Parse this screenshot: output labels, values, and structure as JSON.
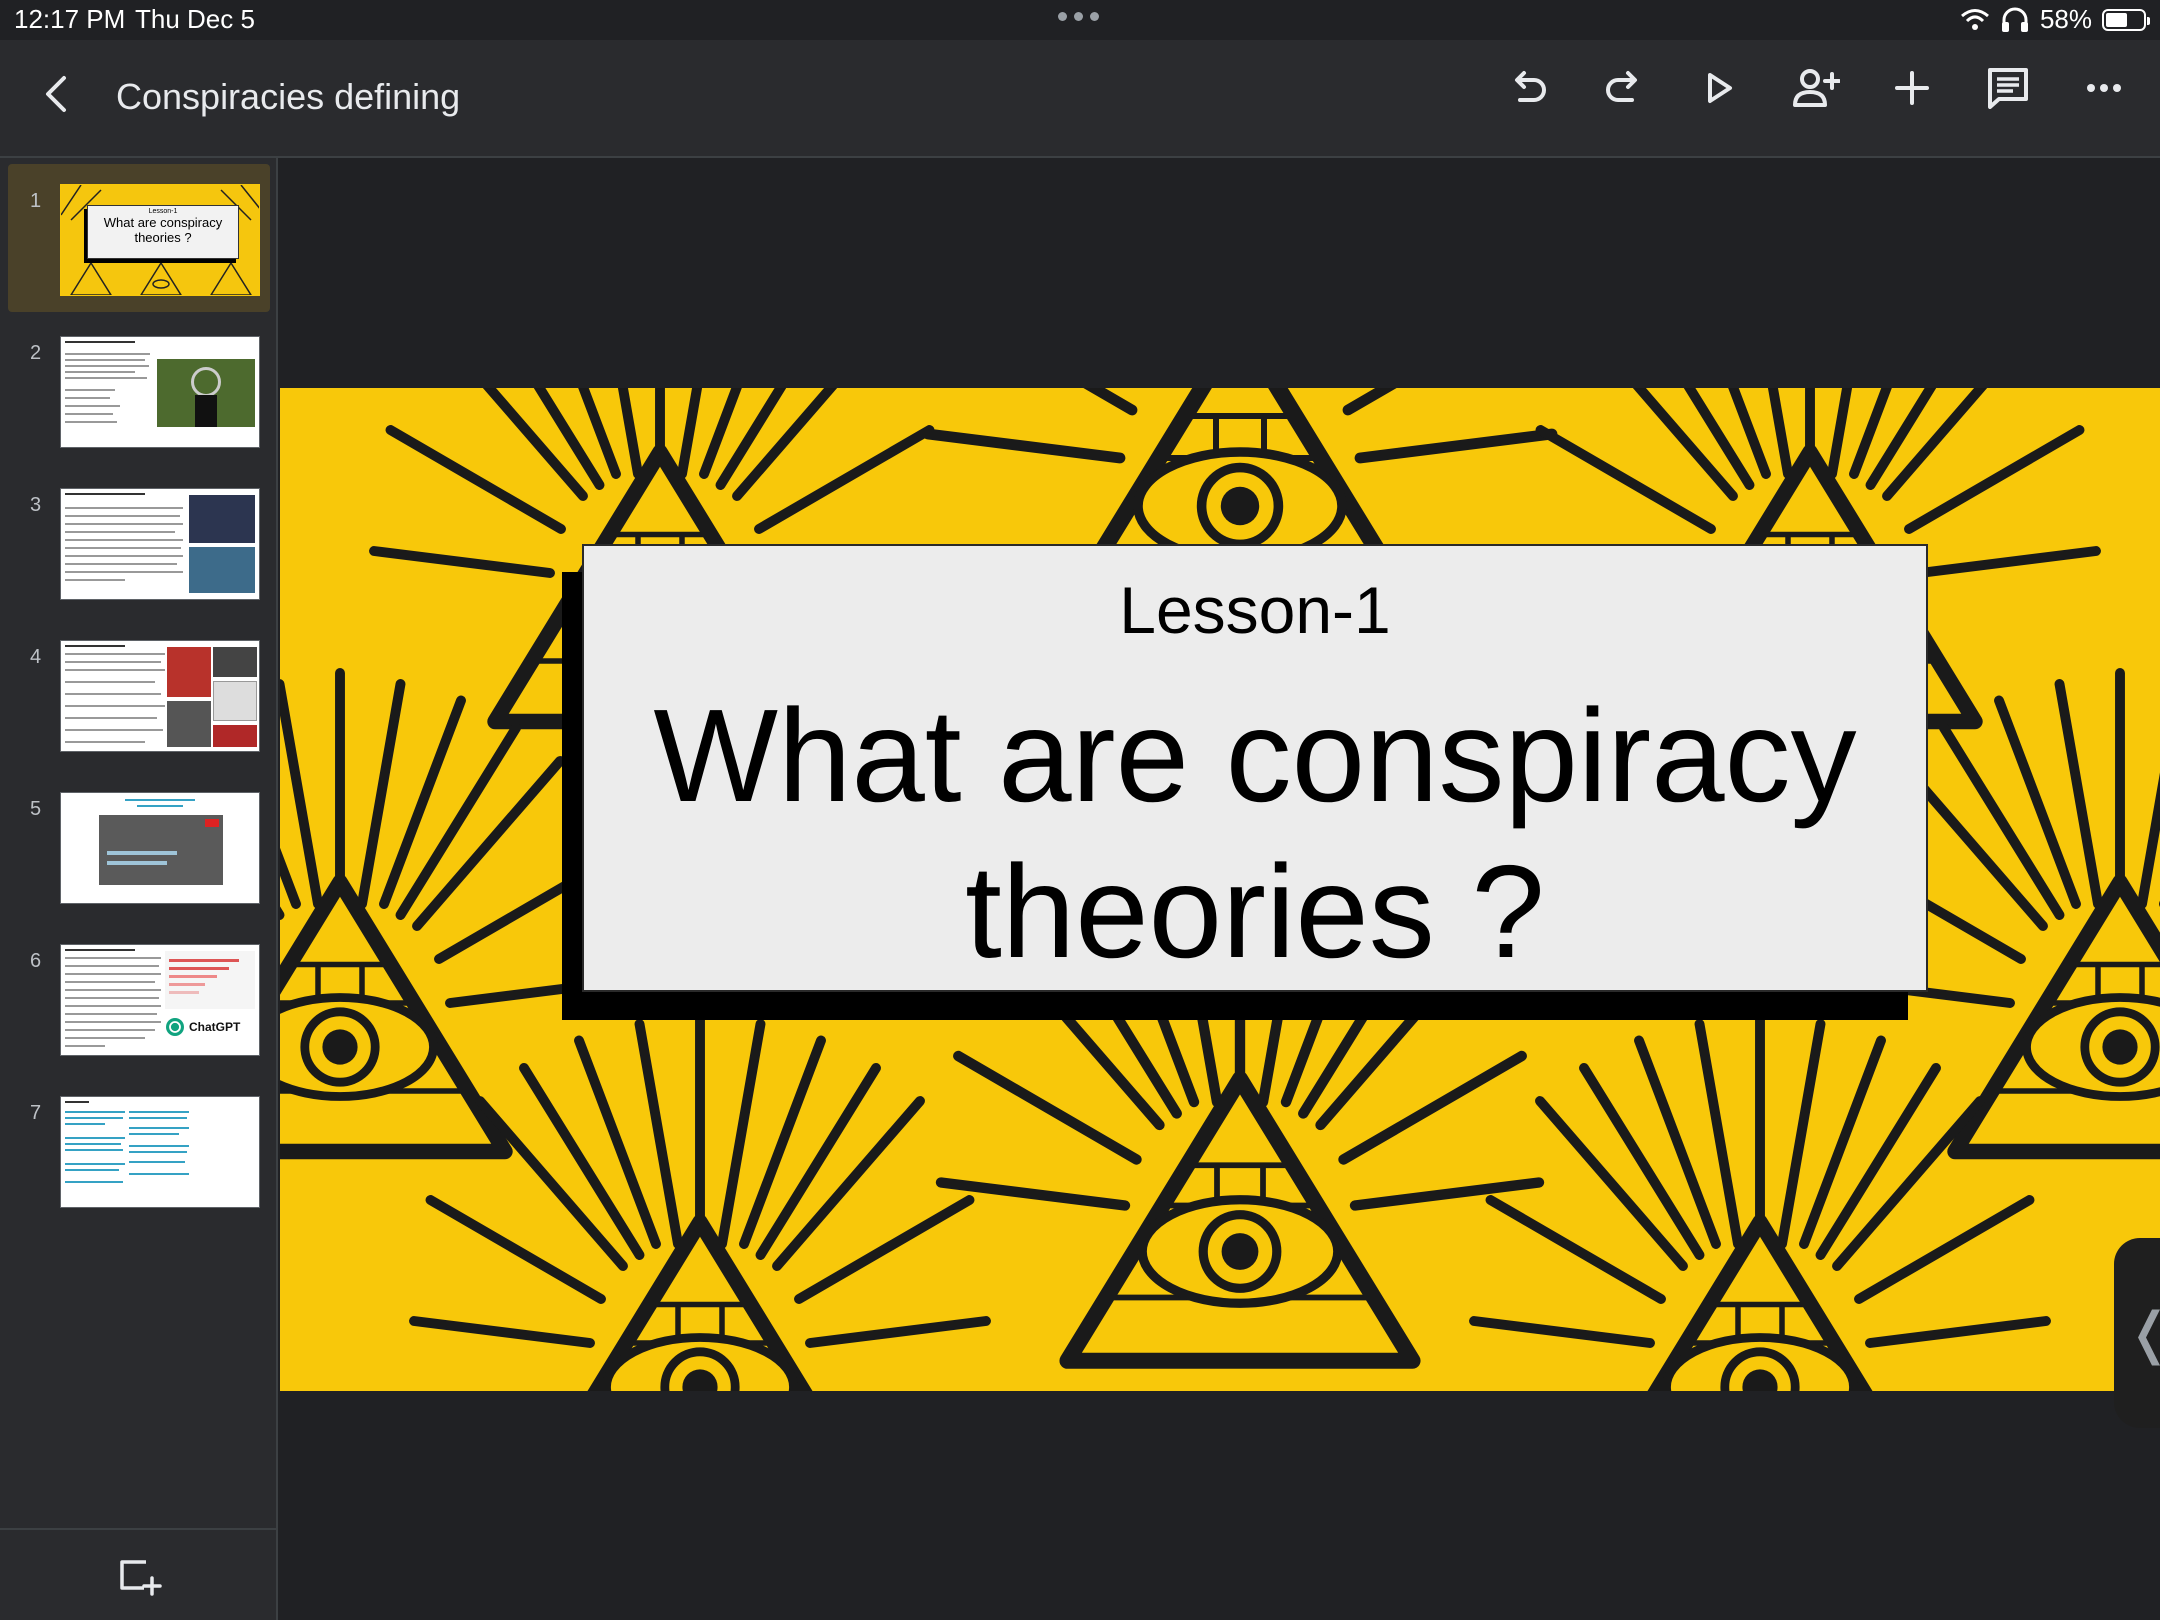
{
  "status_bar": {
    "time": "12:17 PM",
    "date": "Thu Dec 5",
    "battery": "58%",
    "battery_level": 0.58
  },
  "toolbar": {
    "title": "Conspiracies defining",
    "icons": [
      "back-icon",
      "undo-icon",
      "redo-icon",
      "present-play-icon",
      "share-add-person-icon",
      "add-icon",
      "comments-icon",
      "more-options-icon"
    ]
  },
  "slides": [
    {
      "number": "1",
      "lesson": "Lesson-1",
      "title": "What are conspiracy theories ?"
    },
    {
      "number": "2"
    },
    {
      "number": "3"
    },
    {
      "number": "4"
    },
    {
      "number": "5"
    },
    {
      "number": "6",
      "logo_label": "ChatGPT"
    },
    {
      "number": "7"
    }
  ],
  "current_slide": {
    "lesson": "Lesson-1",
    "title": "What are conspiracy theories ?",
    "background_color": "#f8c80a"
  }
}
